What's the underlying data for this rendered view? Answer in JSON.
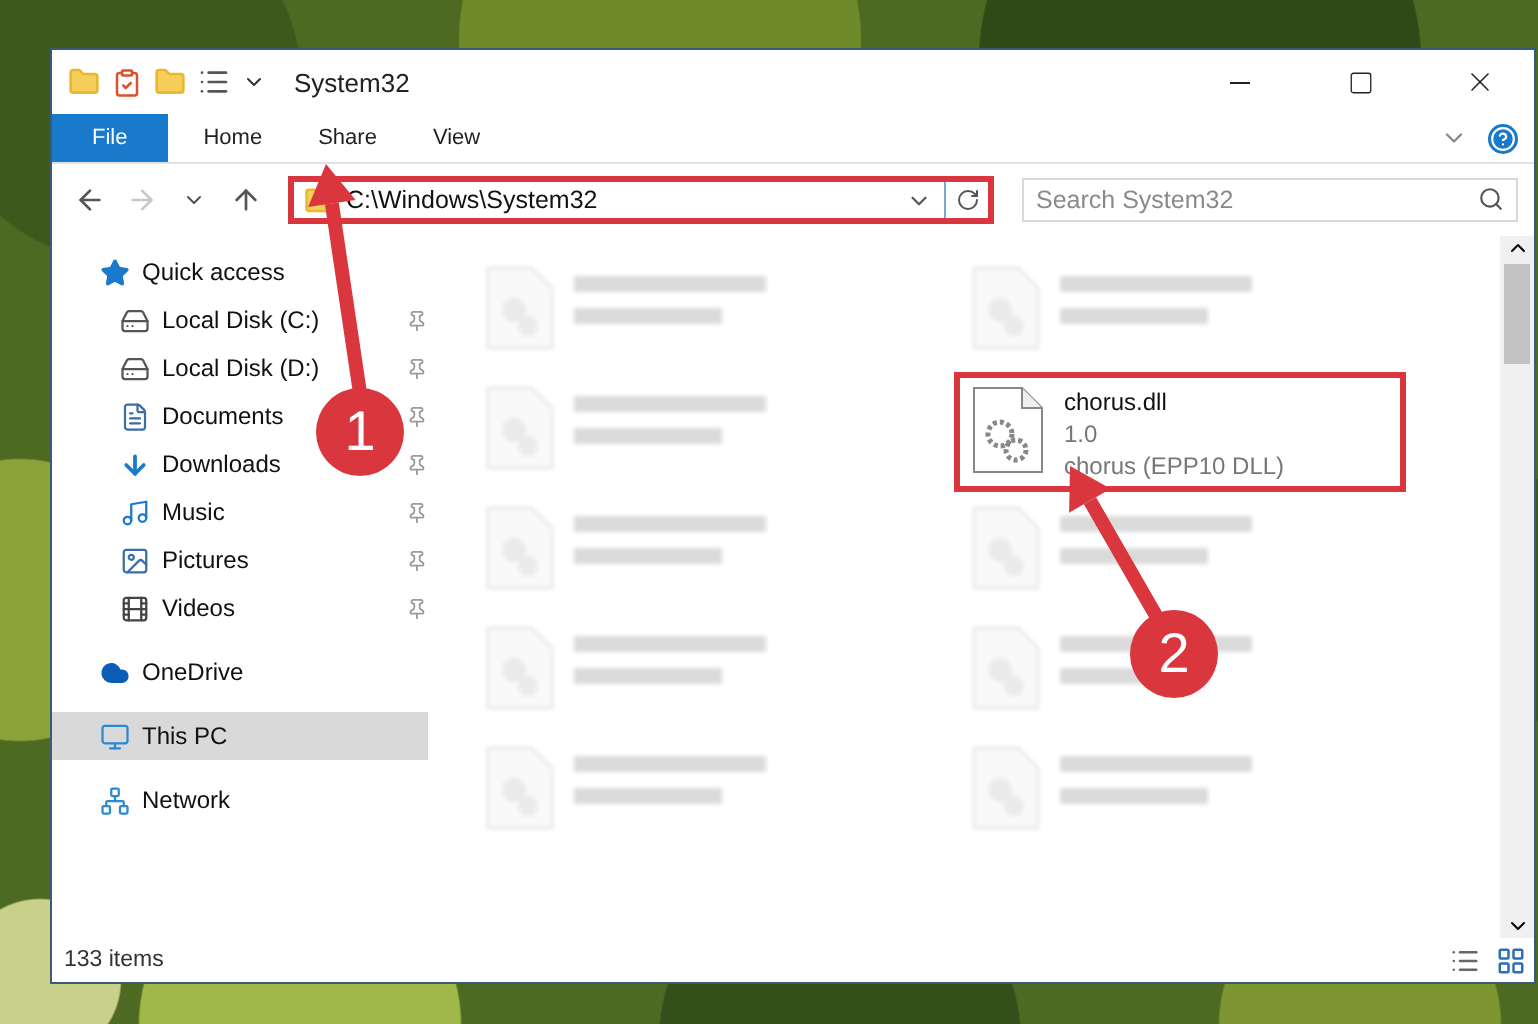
{
  "window": {
    "title": "System32"
  },
  "ribbon_tabs": [
    {
      "label": "File",
      "selected": true
    },
    {
      "label": "Home",
      "selected": false
    },
    {
      "label": "Share",
      "selected": false
    },
    {
      "label": "View",
      "selected": false
    }
  ],
  "address": {
    "value": "C:\\Windows\\System32",
    "highlighted": true
  },
  "search": {
    "placeholder": "Search System32"
  },
  "sidebar": {
    "items": [
      {
        "label": "Quick access",
        "kind": "star",
        "selected": false,
        "children": [
          {
            "label": "Local Disk (C:)",
            "kind": "drive-windows",
            "pinned": true,
            "selected": false
          },
          {
            "label": "Local Disk (D:)",
            "kind": "drive",
            "pinned": true,
            "selected": false
          },
          {
            "label": "Documents",
            "kind": "document",
            "pinned": true,
            "selected": false
          },
          {
            "label": "Downloads",
            "kind": "download",
            "pinned": true,
            "selected": false
          },
          {
            "label": "Music",
            "kind": "music",
            "pinned": true,
            "selected": false
          },
          {
            "label": "Pictures",
            "kind": "pictures",
            "pinned": true,
            "selected": false
          },
          {
            "label": "Videos",
            "kind": "videos",
            "pinned": true,
            "selected": false
          }
        ]
      },
      {
        "label": "OneDrive",
        "kind": "cloud",
        "selected": false
      },
      {
        "label": "This PC",
        "kind": "pc",
        "selected": true
      },
      {
        "label": "Network",
        "kind": "network",
        "selected": false
      }
    ]
  },
  "files": [
    {
      "kind": "blurred"
    },
    {
      "kind": "blurred"
    },
    {
      "kind": "blurred"
    },
    {
      "kind": "file",
      "name": "chorus.dll",
      "version": "1.0",
      "type": "chorus (EPP10 DLL)",
      "highlighted": true
    },
    {
      "kind": "blurred"
    },
    {
      "kind": "blurred"
    },
    {
      "kind": "blurred"
    },
    {
      "kind": "blurred"
    },
    {
      "kind": "blurred"
    },
    {
      "kind": "blurred"
    }
  ],
  "status_bar": {
    "item_count": "133 items"
  },
  "annotations": [
    {
      "label": "1"
    },
    {
      "label": "2"
    }
  ]
}
